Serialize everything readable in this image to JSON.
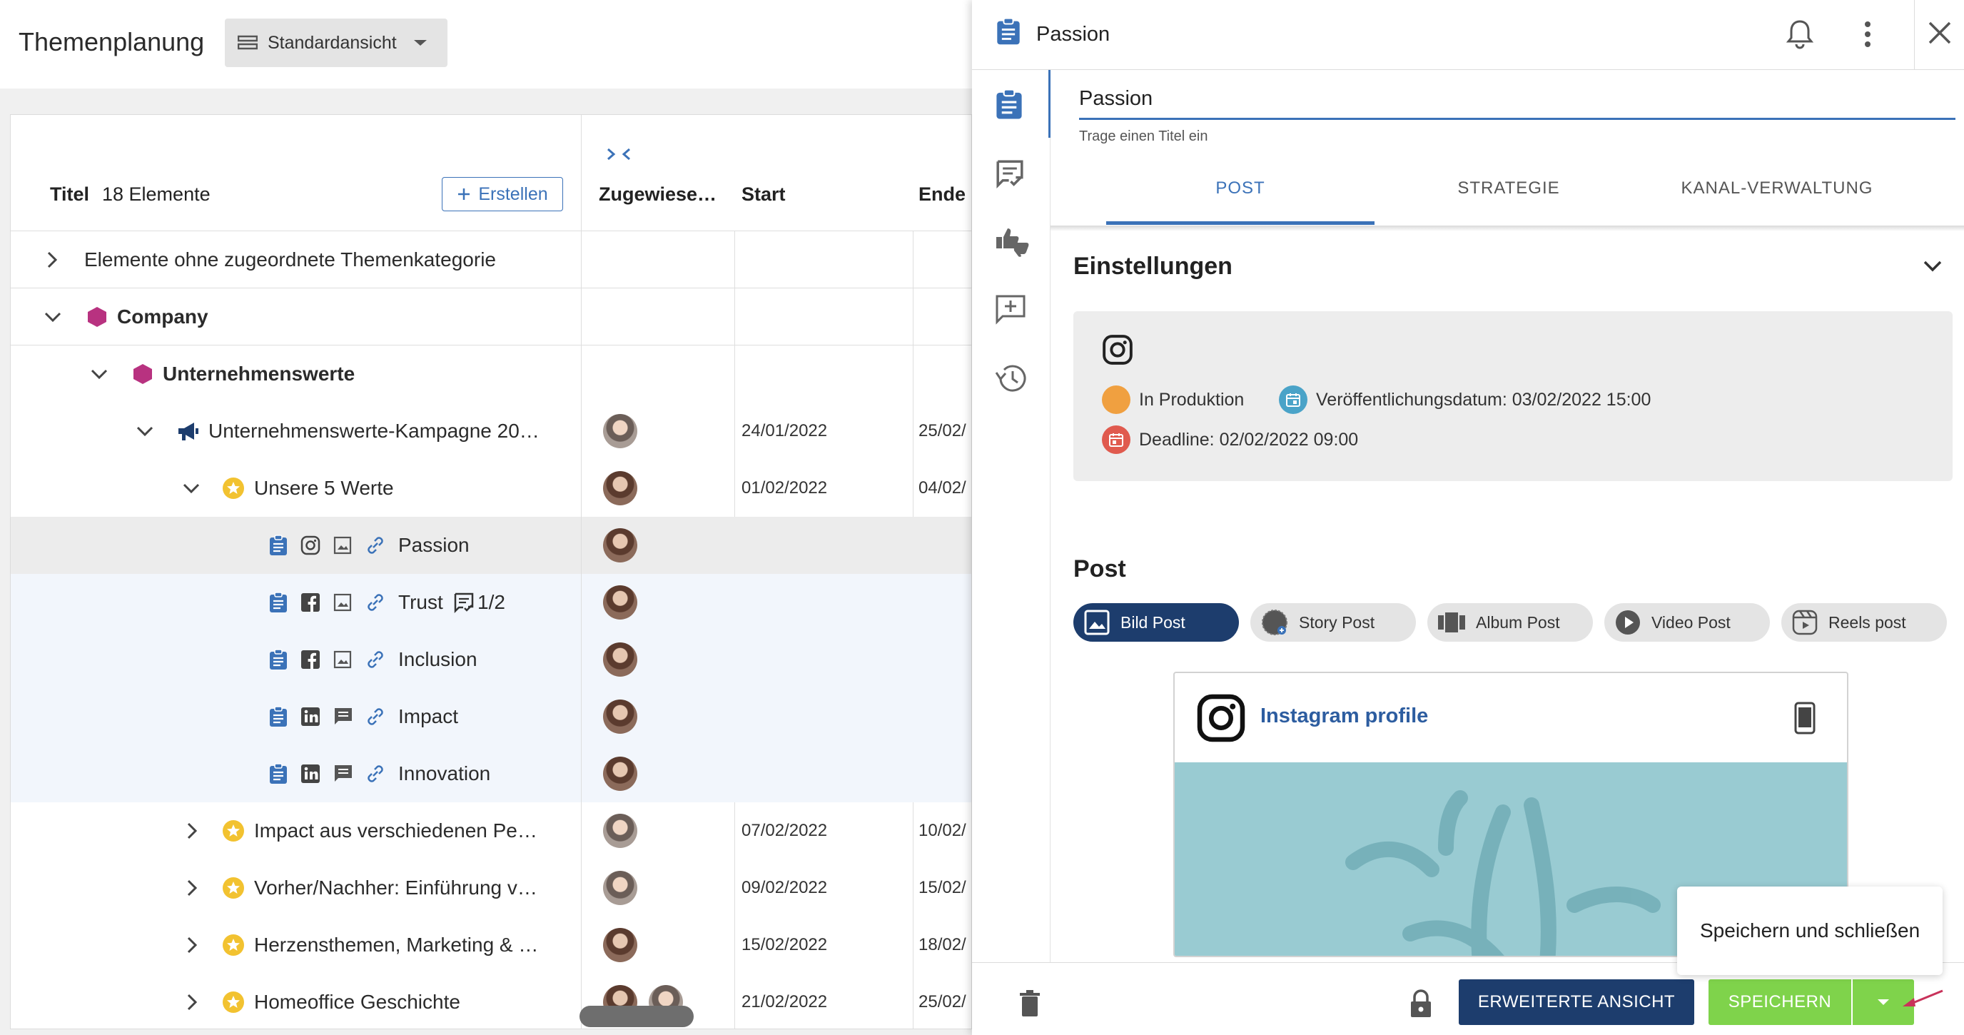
{
  "app": {
    "title": "Themenplanung",
    "view_label": "Standardansicht"
  },
  "grid": {
    "title_col": "Titel",
    "count": "18 Elemente",
    "create_label": "Erstellen",
    "cols": {
      "assigned": "Zugewiese…",
      "start": "Start",
      "end": "Ende"
    },
    "rows": [
      {
        "label": "Elemente ohne zugeordnete Themenkategorie"
      },
      {
        "label": "Company"
      },
      {
        "label": "Unternehmenswerte"
      },
      {
        "label": "Unternehmenswerte-Kampagne 20…",
        "start": "24/01/2022",
        "end": "25/02/"
      },
      {
        "label": "Unsere 5 Werte",
        "start": "01/02/2022",
        "end": "04/02/"
      },
      {
        "label": "Passion"
      },
      {
        "label": "Trust",
        "badge": "1/2"
      },
      {
        "label": "Inclusion"
      },
      {
        "label": "Impact"
      },
      {
        "label": "Innovation"
      },
      {
        "label": "Impact aus verschiedenen Pe…",
        "start": "07/02/2022",
        "end": "10/02/"
      },
      {
        "label": "Vorher/Nachher: Einführung v…",
        "start": "09/02/2022",
        "end": "15/02/"
      },
      {
        "label": "Herzensthemen, Marketing & …",
        "start": "15/02/2022",
        "end": "18/02/"
      },
      {
        "label": "Homeoffice Geschichte",
        "start": "21/02/2022",
        "end": "25/02/"
      }
    ]
  },
  "panel": {
    "header_title": "Passion",
    "title_value": "Passion",
    "title_helper": "Trage einen Titel ein",
    "tabs": [
      "POST",
      "STRATEGIE",
      "KANAL-VERWALTUNG"
    ],
    "settings_title": "Einstellungen",
    "status": "In Produktion",
    "publish_date": "Veröffentlichungsdatum: 03/02/2022 15:00",
    "deadline": "Deadline: 02/02/2022 09:00",
    "post_title": "Post",
    "post_types": [
      "Bild Post",
      "Story Post",
      "Album Post",
      "Video Post",
      "Reels post"
    ],
    "preview_profile": "Instagram profile",
    "buttons": {
      "extended": "ERWEITERTE ANSICHT",
      "save": "SPEICHERN"
    },
    "save_menu_item": "Speichern und schließen"
  },
  "colors": {
    "accent": "#3b72b8",
    "navy": "#1d3d6d",
    "save_green": "#7fd34b",
    "category": "#b83280",
    "status_orange": "#f0a040",
    "date_teal": "#4aa3c8",
    "deadline_red": "#e05a4e",
    "selected_row": "#ececec",
    "child_rows": "#f2f6fc",
    "preview_bg": "#99cbd2"
  },
  "icons": [
    "view-icon",
    "chevron-down-icon",
    "plus-icon",
    "collapse-columns-icon",
    "chevron-right-icon",
    "hexagon-icon",
    "megaphone-icon",
    "star-icon",
    "clipboard-icon",
    "instagram-icon",
    "facebook-icon",
    "linkedin-icon",
    "image-icon",
    "comment-icon",
    "link-icon",
    "bell-icon",
    "more-vert-icon",
    "close-icon",
    "checklist-icon",
    "thumbs-icon",
    "add-comment-icon",
    "history-icon",
    "calendar-icon",
    "mobile-icon",
    "trash-icon",
    "lock-icon",
    "arrow-down-icon"
  ]
}
